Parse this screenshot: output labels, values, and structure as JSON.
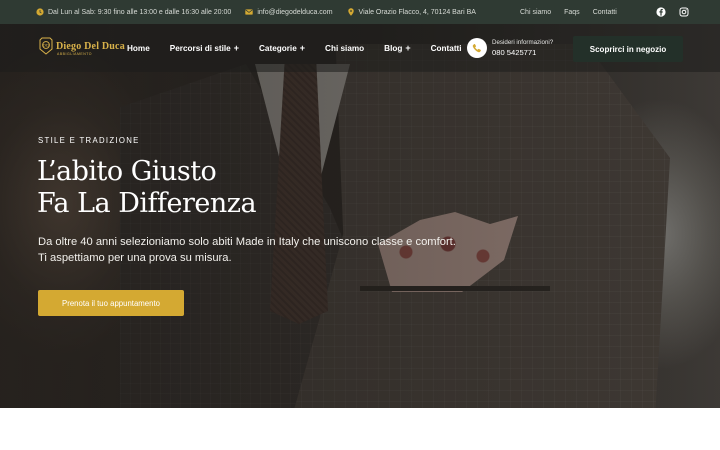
{
  "topbar": {
    "hours": "Dal Lun al Sab: 9:30 fino alle 13:00 e dalle 16:30 alle 20:00",
    "email": "info@diegodelduca.com",
    "address": "Viale Orazio Flacco, 4, 70124 Bari BA",
    "links": [
      "Chi siamo",
      "Faqs",
      "Contatti"
    ],
    "social": [
      "facebook-icon",
      "instagram-icon"
    ]
  },
  "nav": {
    "logo_text": "Diego Del Duca",
    "logo_sub": "ABBIGLIAMENTO",
    "menu": [
      {
        "label": "Home",
        "plus": ""
      },
      {
        "label": "Percorsi di stile",
        "plus": "+"
      },
      {
        "label": "Categorie",
        "plus": "+"
      },
      {
        "label": "Chi siamo",
        "plus": ""
      },
      {
        "label": "Blog",
        "plus": "+"
      },
      {
        "label": "Contatti",
        "plus": ""
      }
    ],
    "info_label": "Desideri informazioni?",
    "info_phone": "080 5425771",
    "store_button": "Scoprirci in negozio"
  },
  "hero": {
    "kicker": "STILE E TRADIZIONE",
    "headline_line1": "L’abito Giusto",
    "headline_line2": "Fa La Differenza",
    "subtitle_line1": "Da oltre 40 anni selezioniamo solo abiti Made in Italy che uniscono classe e comfort.",
    "subtitle_line2": "Ti aspettiamo per una prova su misura.",
    "cta": "Prenota il tuo appuntamento"
  },
  "colors": {
    "topbar_bg": "#2f3a33",
    "accent_gold": "#d4a932",
    "store_button_bg": "#233029"
  }
}
